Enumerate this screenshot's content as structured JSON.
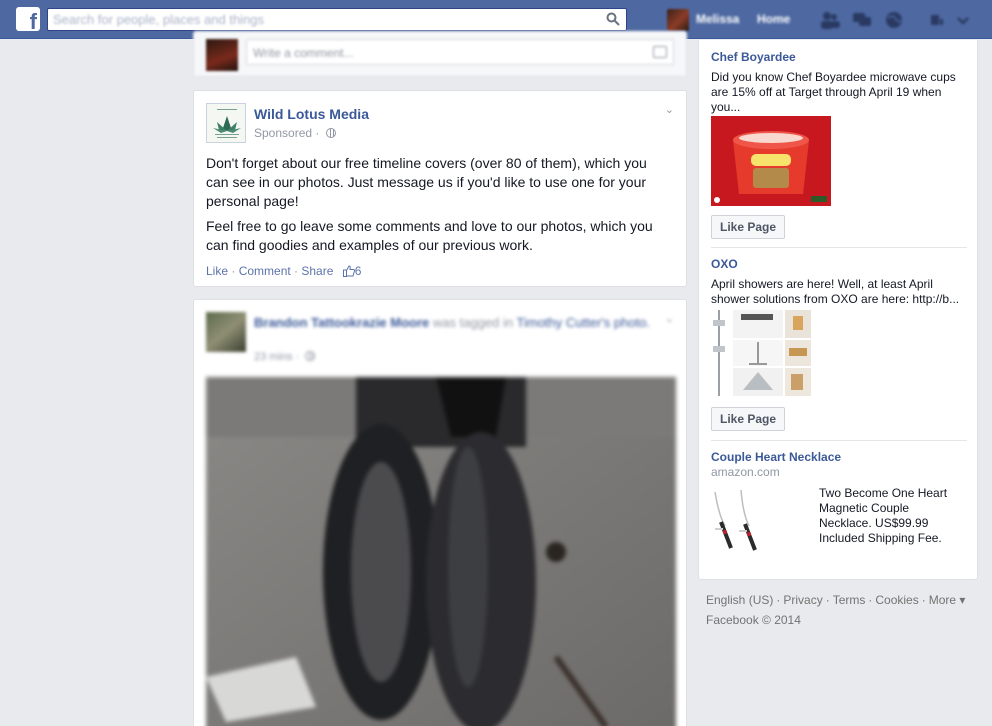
{
  "topbar": {
    "search_placeholder": "Search for people, places and things",
    "user_name": "Melissa",
    "home_label": "Home"
  },
  "comment_row": {
    "placeholder": "Write a comment..."
  },
  "post1": {
    "page_name": "Wild Lotus Media",
    "sponsored_label": "Sponsored",
    "paragraphs": [
      "Don't forget about our free timeline covers (over 80 of them), which you can see in our photos. Just message us if you'd like to use one for your personal page!",
      "Feel free to go leave some comments and love to our photos, which you can find goodies and examples of our previous work."
    ],
    "actions": {
      "like": "Like",
      "comment": "Comment",
      "share": "Share",
      "like_count": "6"
    }
  },
  "post2": {
    "author": "Brandon Tattookrazie Moore",
    "tagged_text": "was tagged in",
    "tagged_by": "Timothy Cutter's",
    "object": "photo.",
    "time": "23 mins"
  },
  "ads": [
    {
      "title": "Chef Boyardee",
      "text": "Did you know Chef Boyardee microwave cups are 15% off at Target through April 19 when you...",
      "button": "Like Page"
    },
    {
      "title": "OXO",
      "text": "April showers are here! Well, at least April shower solutions from OXO are here: http://b...",
      "button": "Like Page"
    },
    {
      "title": "Couple Heart Necklace",
      "domain": "amazon.com",
      "text": "Two Become One Heart Magnetic Couple Necklace. US$99.99 Included Shipping Fee."
    }
  ],
  "footer": {
    "links": [
      "English (US)",
      "Privacy",
      "Terms",
      "Cookies",
      "More"
    ],
    "copyright": "Facebook © 2014"
  },
  "colors": {
    "topbar": "#4e69a2",
    "link": "#3b5998",
    "background": "#e9eaed"
  }
}
